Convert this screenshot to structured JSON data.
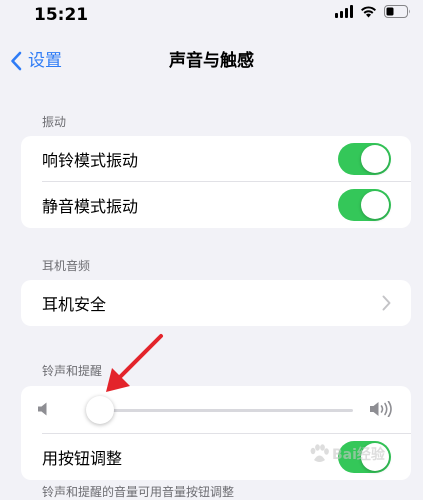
{
  "status_bar": {
    "time": "15:21",
    "icons": [
      "cellular-signal-icon",
      "wifi-icon",
      "battery-icon"
    ]
  },
  "nav": {
    "back_label": "设置",
    "title": "声音与触感"
  },
  "sections": {
    "vibration": {
      "header": "振动",
      "rows": [
        {
          "label": "响铃模式振动",
          "toggle_on": true
        },
        {
          "label": "静音模式振动",
          "toggle_on": true
        }
      ]
    },
    "headphone_audio": {
      "header": "耳机音频",
      "rows": [
        {
          "label": "耳机安全"
        }
      ]
    },
    "ringer_alerts": {
      "header": "铃声和提醒",
      "volume_level": 0.05,
      "change_with_buttons": {
        "label": "用按钮调整",
        "toggle_on": true
      }
    }
  },
  "footer_note": "铃声和提醒的音量可用音量按钮调整",
  "watermark": {
    "text": "Bai经验"
  },
  "colors": {
    "accent_blue": "#2f7cf6",
    "toggle_green": "#34c759",
    "annotation_red": "#e3242b",
    "background": "#f2f2f7"
  }
}
